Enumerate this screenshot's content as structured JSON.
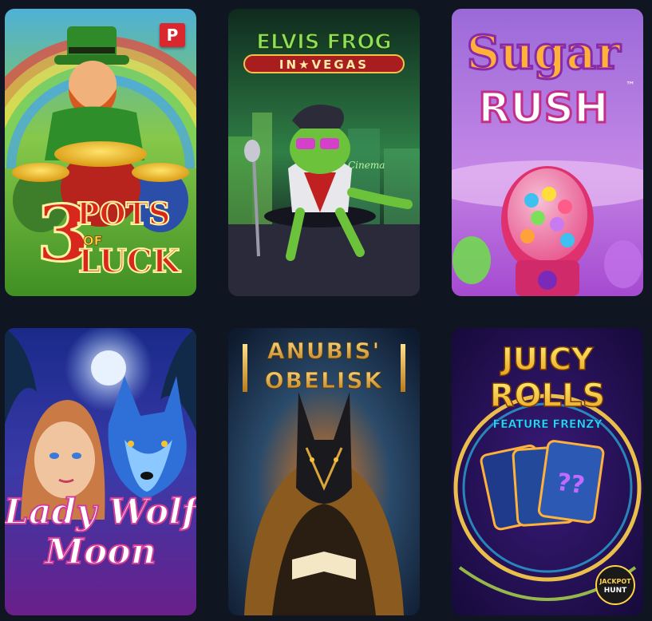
{
  "games": [
    {
      "title_main": "3",
      "title_line1": "POTS",
      "title_of": "OF",
      "title_line2": "LUCK",
      "badge": "P"
    },
    {
      "title_line1": "ELVIS FROG",
      "title_line2": "IN★VEGAS",
      "sign": "Cinema"
    },
    {
      "title_line1": "Sugar",
      "title_line2": "RUSH",
      "trademark": "™"
    },
    {
      "title_line1": "Lady Wolf",
      "title_line2": "Moon"
    },
    {
      "title_line1": "ANUBIS'",
      "title_line2": "OBELISK"
    },
    {
      "title_line1": "JUICY",
      "title_line2": "ROLLS",
      "subtitle": "FEATURE FRENZY",
      "card_symbol": "??",
      "logo_line1": "JACKPOT",
      "logo_line2": "HUNT"
    }
  ],
  "colors": {
    "page_background": "#0f1622",
    "badge_red": "#d9262f"
  }
}
